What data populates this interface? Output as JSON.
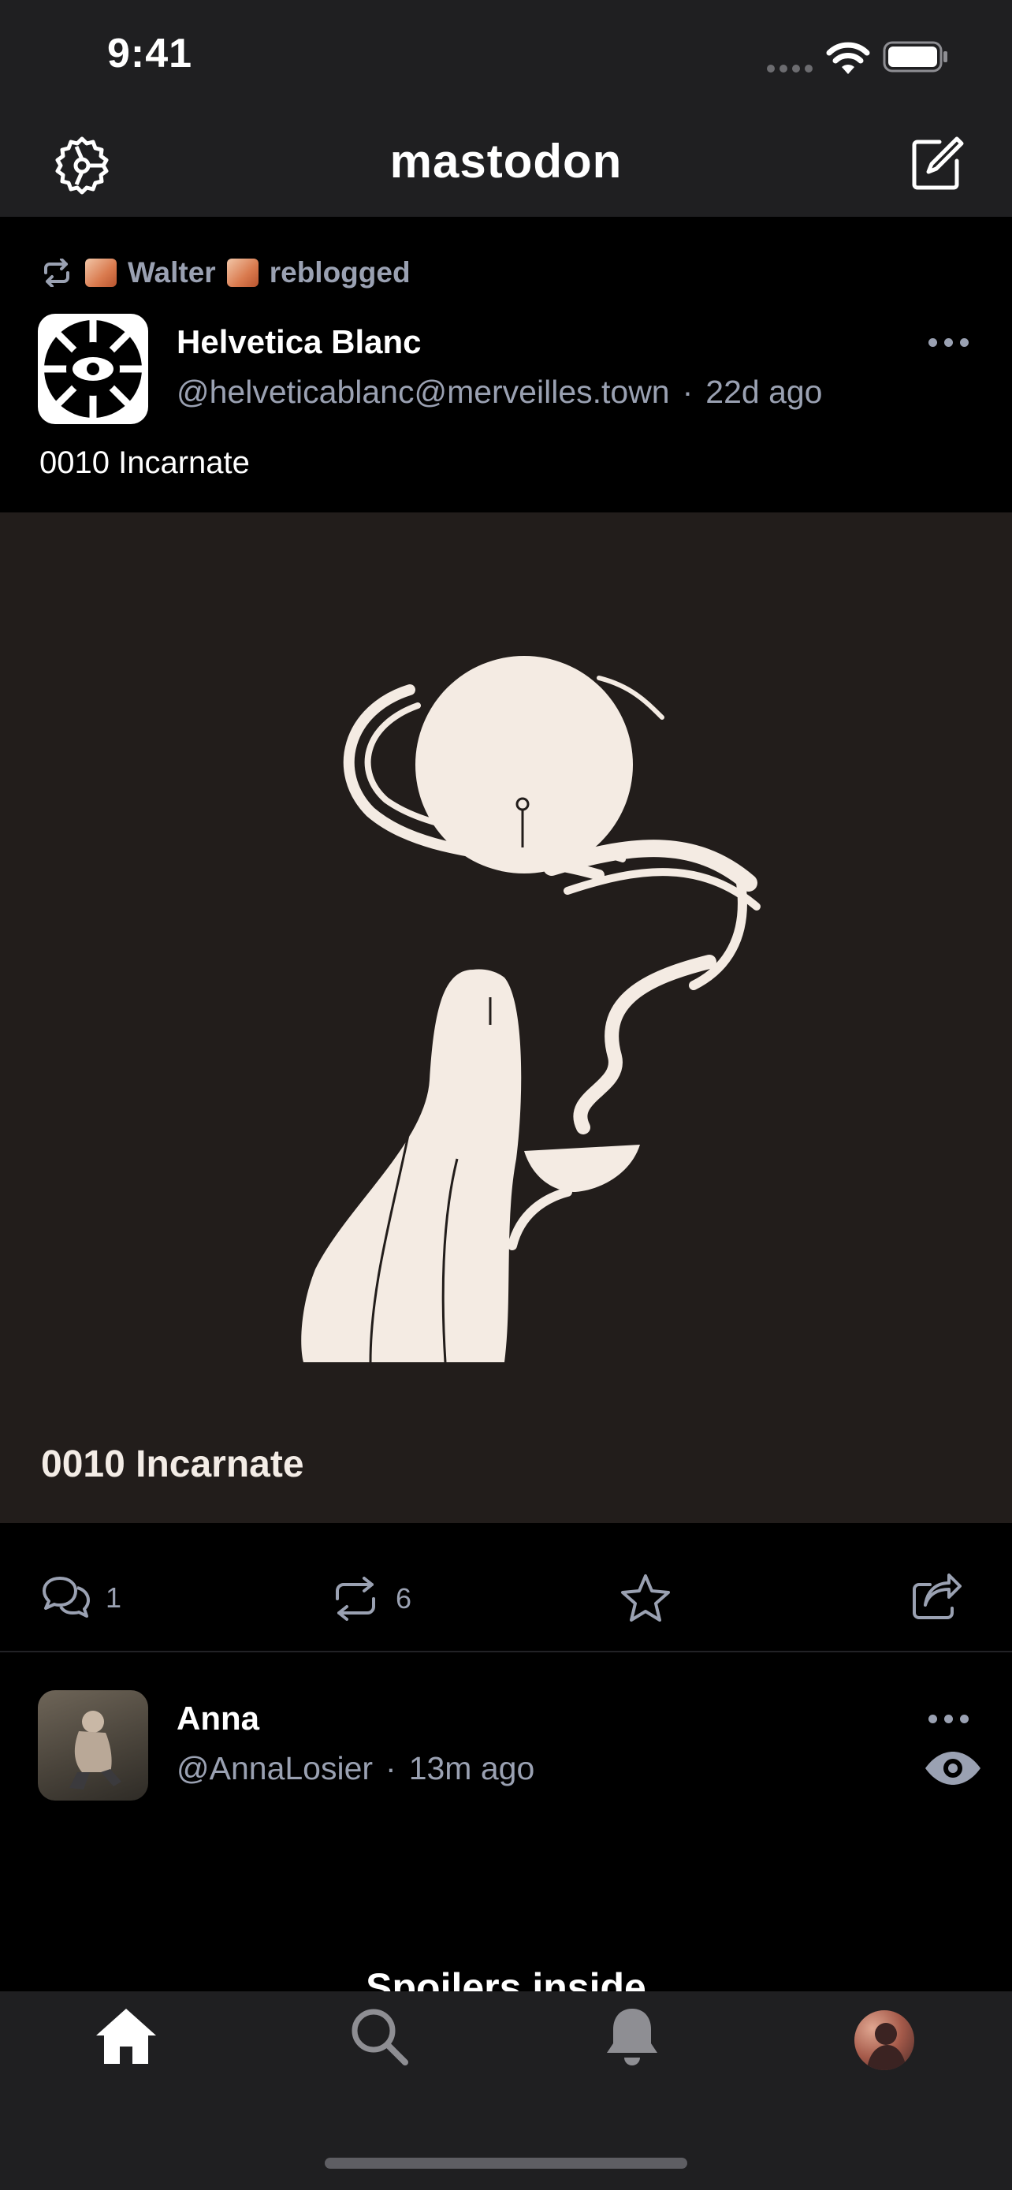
{
  "status_bar": {
    "time": "9:41"
  },
  "nav": {
    "title": "mastodon",
    "settings_icon": "gear-icon",
    "compose_icon": "compose-icon"
  },
  "post1": {
    "reblog": {
      "booster": "Walter",
      "action": "reblogged"
    },
    "display_name": "Helvetica Blanc",
    "handle": "@helveticablanc@merveilles.town",
    "separator": "·",
    "age": "22d ago",
    "content": "0010 Incarnate",
    "media_caption": "0010 Incarnate",
    "replies": "1",
    "boosts": "6"
  },
  "post2": {
    "display_name": "Anna",
    "handle": "@AnnaLosier",
    "separator": "·",
    "age": "13m ago",
    "content_warning": "Spoilers inside"
  },
  "tab_bar": {
    "items": [
      "home-icon",
      "search-icon",
      "bell-icon",
      "profile-avatar"
    ]
  },
  "colors": {
    "background": "#000000",
    "bars": "#1f1f21",
    "secondary_text": "#9aa1b2",
    "media_background": "#221d1b"
  }
}
